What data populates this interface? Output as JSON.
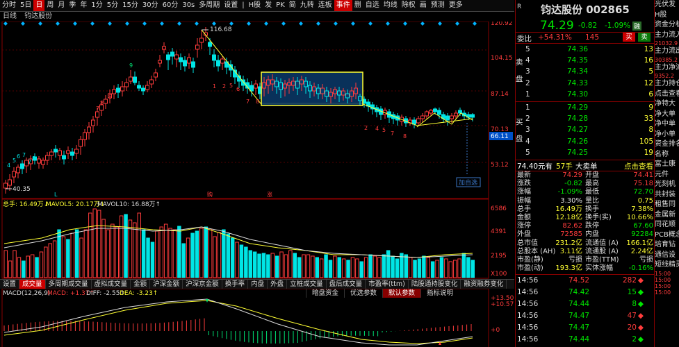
{
  "toolbar": {
    "items": [
      {
        "label": "分时",
        "active": false
      },
      {
        "label": "5日",
        "active": false
      },
      {
        "label": "日",
        "active": true
      },
      {
        "label": "周",
        "active": false
      },
      {
        "label": "月",
        "active": false
      },
      {
        "label": "季",
        "active": false
      },
      {
        "label": "年",
        "active": false
      },
      {
        "label": "1分",
        "active": false
      },
      {
        "label": "5分",
        "active": false
      },
      {
        "label": "15分",
        "active": false
      },
      {
        "label": "30分",
        "active": false
      },
      {
        "label": "60分",
        "active": false
      },
      {
        "label": "30s",
        "active": false
      },
      {
        "label": "多周期",
        "active": false
      },
      {
        "label": "设置",
        "active": false
      },
      {
        "label": "|",
        "active": false
      },
      {
        "label": "H股",
        "active": false
      },
      {
        "label": "发",
        "active": false
      },
      {
        "label": "PK",
        "active": false
      },
      {
        "label": "简",
        "active": false
      },
      {
        "label": "九转",
        "active": false
      },
      {
        "label": "连板",
        "active": false
      },
      {
        "label": "事件",
        "active": true
      },
      {
        "label": "删",
        "active": false
      },
      {
        "label": "自选",
        "active": false
      },
      {
        "label": "均线",
        "active": false
      },
      {
        "label": "除权",
        "active": false
      },
      {
        "label": "画",
        "active": false
      },
      {
        "label": "预测",
        "active": false
      },
      {
        "label": "更多",
        "active": false
      }
    ]
  },
  "subbar": {
    "left": "日线",
    "name": "钧达股份"
  },
  "chart": {
    "price_axis": [
      "120.92",
      "104.15",
      "87.14",
      "70.13",
      "53.12"
    ],
    "current_price_tag": "66.11",
    "high_annot": "116.68",
    "low_annot": "40.35",
    "add_watch": "加自选",
    "markers": [
      {
        "text": "L",
        "color": "#00e5e5"
      },
      {
        "text": "购",
        "color": "#ff3c3c"
      },
      {
        "text": "涨",
        "color": "#ff3c3c"
      }
    ],
    "volume_header": {
      "total": "总手: 16.49万↓",
      "ma5": "MAVOL5: 20.17万↓",
      "ma10": "MAVOL10: 16.88万↑"
    },
    "volume_axis": [
      "6586",
      "4391",
      "2195",
      "X100"
    ],
    "macd_header": {
      "name": "MACD(12,26,9)",
      "macd": "MACD: +1.37↑",
      "diff": "DIFF: -2.55↑",
      "dea": "DEA: -3.23↑"
    },
    "macd_axis": [
      "+13.50",
      "+10.57",
      "+0"
    ]
  },
  "tabs": [
    {
      "label": "设置",
      "active": false
    },
    {
      "label": "成交量",
      "active": true
    },
    {
      "label": "多周期成交量",
      "active": false
    },
    {
      "label": "虚拟成交量",
      "active": false
    },
    {
      "label": "金额",
      "active": false
    },
    {
      "label": "沪深金额",
      "active": false
    },
    {
      "label": "沪深京金额",
      "active": false
    },
    {
      "label": "换手率",
      "active": false
    },
    {
      "label": "内盘",
      "active": false
    },
    {
      "label": "外盘",
      "active": false
    },
    {
      "label": "立桩成交量",
      "active": false
    },
    {
      "label": "盘后成交量",
      "active": false
    },
    {
      "label": "市盈率(ttm)",
      "active": false
    },
    {
      "label": "陆股通持股变化",
      "active": false
    },
    {
      "label": "融资融券变化",
      "active": false
    }
  ],
  "subtabs": [
    {
      "label": "暗盘资金",
      "active": false
    },
    {
      "label": "优选参数",
      "active": false
    },
    {
      "label": "默认参数",
      "active": true
    },
    {
      "label": "指标说明",
      "active": false
    }
  ],
  "quote": {
    "r": "R",
    "title": "钧达股份 002865",
    "price": "74.29",
    "change": "-0.82",
    "pct": "-1.09%",
    "tag": "融",
    "weibi_label": "委比",
    "weibi": "+54.31%",
    "weicha": "145",
    "buy_btn": "买",
    "sell_btn": "卖",
    "sell_label": "卖盘",
    "buy_label": "买盘",
    "asks": [
      {
        "lvl": "5",
        "price": "74.36",
        "vol": "13"
      },
      {
        "lvl": "4",
        "price": "74.35",
        "vol": "16"
      },
      {
        "lvl": "3",
        "price": "74.34",
        "vol": "5"
      },
      {
        "lvl": "2",
        "price": "74.33",
        "vol": "12"
      },
      {
        "lvl": "1",
        "price": "74.30",
        "vol": "6"
      }
    ],
    "bids": [
      {
        "lvl": "1",
        "price": "74.29",
        "vol": "9"
      },
      {
        "lvl": "2",
        "price": "74.28",
        "vol": "33"
      },
      {
        "lvl": "3",
        "price": "74.27",
        "vol": "8"
      },
      {
        "lvl": "4",
        "price": "74.26",
        "vol": "105"
      },
      {
        "lvl": "5",
        "price": "74.25",
        "vol": "19"
      }
    ],
    "bigorder": {
      "amount": "74.40元有",
      "hands": "57手",
      "label": "大卖单",
      "link": "点击查看"
    },
    "stats": [
      {
        "l1": "最新",
        "v1": "74.29",
        "c1": "red",
        "l2": "开盘",
        "v2": "74.41",
        "c2": "red"
      },
      {
        "l1": "涨跌",
        "v1": "-0.82",
        "c1": "green",
        "l2": "最高",
        "v2": "75.18",
        "c2": "red"
      },
      {
        "l1": "涨幅",
        "v1": "-1.09%",
        "c1": "green",
        "l2": "最低",
        "v2": "72.70",
        "c2": "green"
      },
      {
        "l1": "振幅",
        "v1": "3.30%",
        "c1": "white",
        "l2": "量比",
        "v2": "0.75",
        "c2": "yellow"
      },
      {
        "l1": "总手",
        "v1": "16.49万",
        "c1": "yellow",
        "l2": "换手",
        "v2": "7.38%",
        "c2": "yellow"
      },
      {
        "l1": "金额",
        "v1": "12.18亿",
        "c1": "yellow",
        "l2": "换手(实)",
        "v2": "10.66%",
        "c2": "yellow"
      },
      {
        "l1": "涨停",
        "v1": "82.62",
        "c1": "red",
        "l2": "跌停",
        "v2": "67.60",
        "c2": "green"
      },
      {
        "l1": "外盘",
        "v1": "72585",
        "c1": "red",
        "l2": "内盘",
        "v2": "92284",
        "c2": "green"
      },
      {
        "l1": "总市值",
        "v1": "231.2亿",
        "c1": "yellow",
        "l2": "流通值 (A)",
        "v2": "166.1亿",
        "c2": "yellow"
      },
      {
        "l1": "总股本 (AH)",
        "v1": "3.11亿",
        "c1": "yellow",
        "l2": "流通股 (A)",
        "v2": "2.24亿",
        "c2": "yellow"
      },
      {
        "l1": "市盈(静)",
        "v1": "亏损",
        "c1": "white",
        "l2": "市盈(TTM)",
        "v2": "亏损",
        "c2": "white"
      },
      {
        "l1": "市盈(动)",
        "v1": "193.3亿",
        "c1": "yellow",
        "l2": "实体涨幅",
        "v2": "-0.16%",
        "c2": "green"
      }
    ],
    "trades": [
      {
        "time": "14:56",
        "price": "74.52",
        "vol": "282",
        "dir": "◆",
        "pc": "red",
        "vc": "red"
      },
      {
        "time": "14:56",
        "price": "74.42",
        "vol": "15",
        "dir": "◆",
        "pc": "green",
        "vc": "green"
      },
      {
        "time": "14:56",
        "price": "74.44",
        "vol": "8",
        "dir": "◆",
        "pc": "green",
        "vc": "green"
      },
      {
        "time": "14:56",
        "price": "74.47",
        "vol": "47",
        "dir": "◆",
        "pc": "green",
        "vc": "red"
      },
      {
        "time": "14:56",
        "price": "74.47",
        "vol": "20",
        "dir": "◆",
        "pc": "green",
        "vc": "red"
      },
      {
        "time": "14:56",
        "price": "74.44",
        "vol": "2",
        "dir": "◆",
        "pc": "green",
        "vc": "green"
      }
    ]
  },
  "farright": [
    "光伏发",
    "H股",
    "资金分析",
    "主力流入",
    "21032.9",
    "主力流出",
    "30385.2",
    "主力净流",
    "9352.2",
    "主力持仓",
    "点击查看",
    "净特大",
    "净大单",
    "净中单",
    "净小单",
    "资金排名",
    "名称",
    "富士康",
    "元件",
    "光刻机",
    "共封装",
    "租售同",
    "金属新",
    "同花顺",
    "PCB概念",
    "培育钻",
    "通信设",
    "短线精灵",
    "15:00",
    "15:00",
    "15:00",
    "15:00"
  ]
}
